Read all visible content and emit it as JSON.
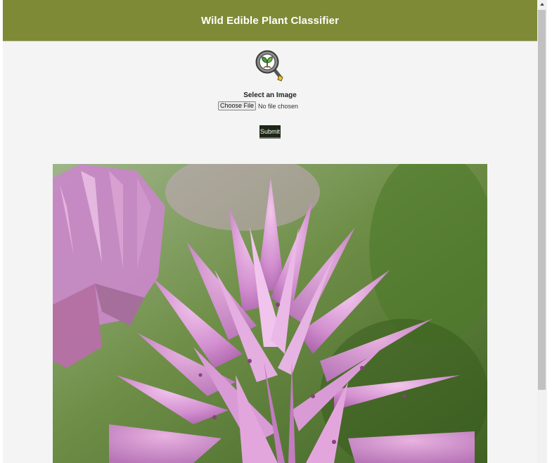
{
  "header": {
    "title": "Wild Edible Plant Classifier",
    "background_color": "#7f8a37"
  },
  "logo": {
    "icon": "magnifier-seedling-icon"
  },
  "upload": {
    "label": "Select an Image",
    "choose_file_label": "Choose File",
    "file_status": "No file chosen"
  },
  "submit": {
    "label": "Submit"
  },
  "image": {
    "alt": "pink chive flower"
  }
}
